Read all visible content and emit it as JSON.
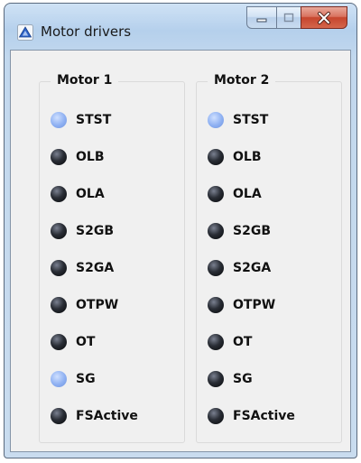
{
  "window": {
    "title": "Motor drivers",
    "icon": "app-triangle-icon"
  },
  "caption_buttons": {
    "minimize": "minimize-icon",
    "maximize": "maximize-icon",
    "close": "close-icon"
  },
  "motors": [
    {
      "title": "Motor 1",
      "flags": [
        {
          "label": "STST",
          "on": true
        },
        {
          "label": "OLB",
          "on": false
        },
        {
          "label": "OLA",
          "on": false
        },
        {
          "label": "S2GB",
          "on": false
        },
        {
          "label": "S2GA",
          "on": false
        },
        {
          "label": "OTPW",
          "on": false
        },
        {
          "label": "OT",
          "on": false
        },
        {
          "label": "SG",
          "on": true
        },
        {
          "label": "FSActive",
          "on": false
        }
      ]
    },
    {
      "title": "Motor 2",
      "flags": [
        {
          "label": "STST",
          "on": true
        },
        {
          "label": "OLB",
          "on": false
        },
        {
          "label": "OLA",
          "on": false
        },
        {
          "label": "S2GB",
          "on": false
        },
        {
          "label": "S2GA",
          "on": false
        },
        {
          "label": "OTPW",
          "on": false
        },
        {
          "label": "OT",
          "on": false
        },
        {
          "label": "SG",
          "on": false
        },
        {
          "label": "FSActive",
          "on": false
        }
      ]
    }
  ],
  "colors": {
    "led_on": "#8eb0f2",
    "led_off": "#1b1e24"
  }
}
